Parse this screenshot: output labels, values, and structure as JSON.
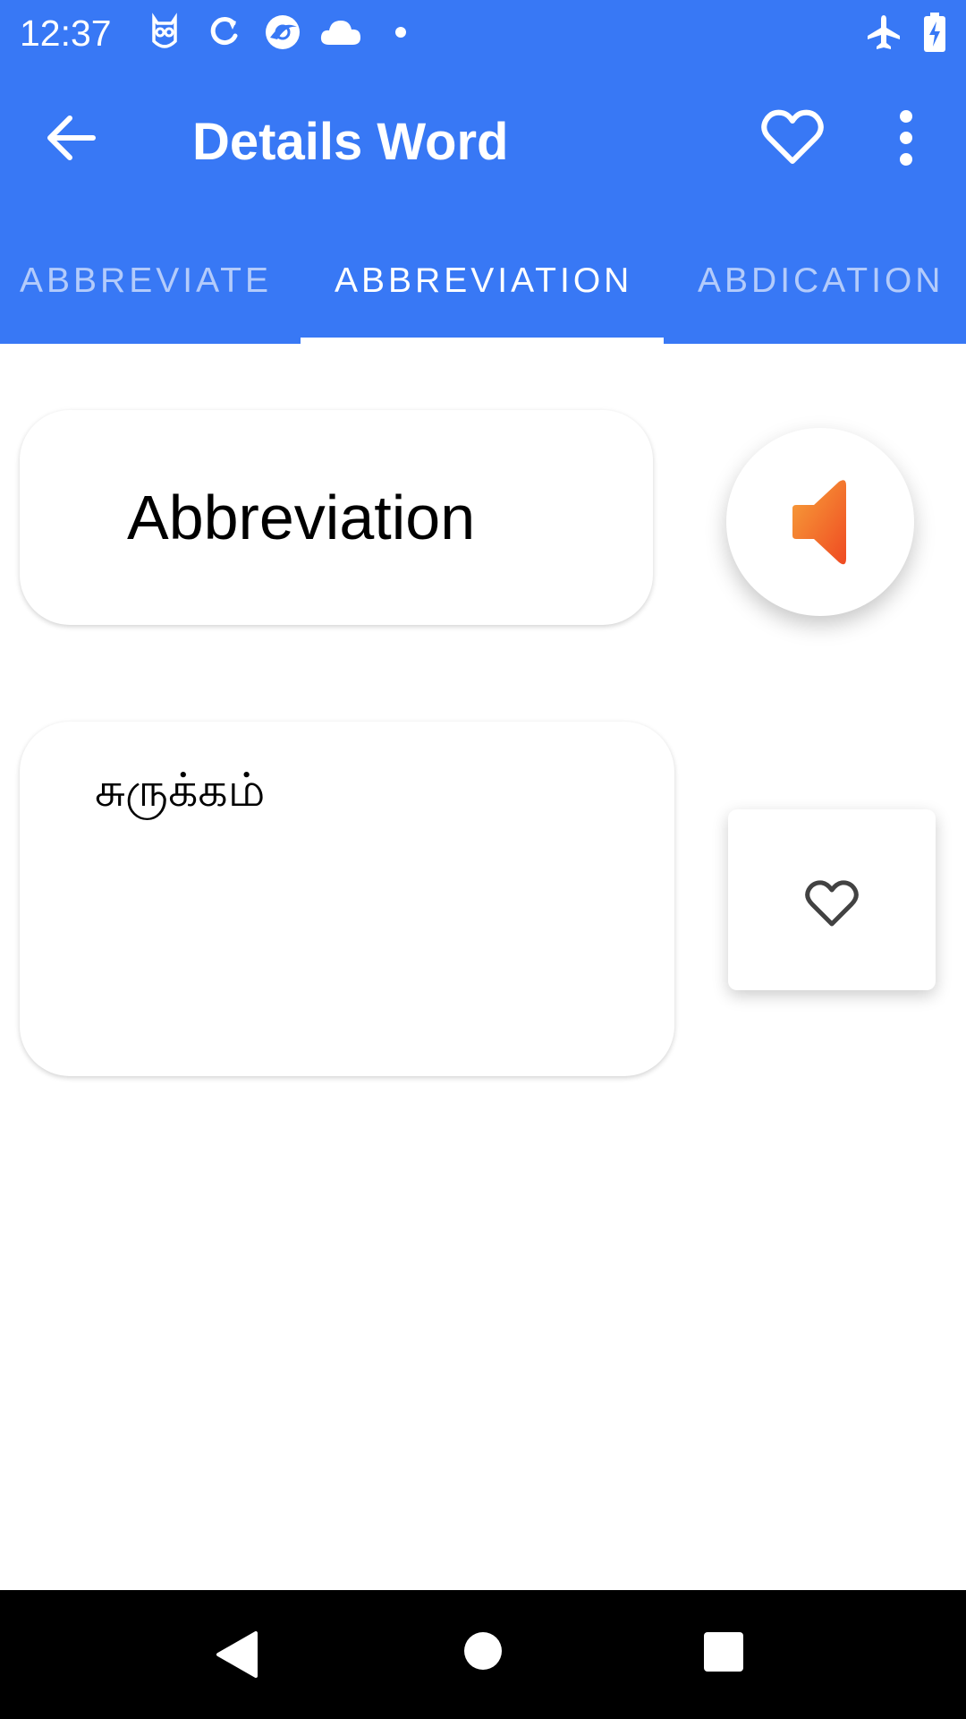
{
  "status_bar": {
    "time": "12:37",
    "icons": [
      "owl-icon",
      "sync-icon",
      "browser-icon",
      "cloud-icon",
      "dot-icon",
      "airplane-mode-icon",
      "battery-charging-icon"
    ]
  },
  "toolbar": {
    "title": "Details Word",
    "back_icon": "arrow-left-icon",
    "favorite_icon": "heart-outline-icon",
    "more_icon": "more-vert-icon"
  },
  "tabs": [
    {
      "label": "ABBREVIATE",
      "active": false
    },
    {
      "label": "ABBREVIATION",
      "active": true
    },
    {
      "label": "ABDICATION",
      "active": false
    }
  ],
  "word": {
    "text": "Abbreviation",
    "speak_icon": "speaker-icon"
  },
  "meaning": {
    "text": "சுருக்கம்"
  },
  "favorite_button_icon": "heart-outline-icon",
  "nav_bar": {
    "icons": [
      "back-triangle-icon",
      "home-circle-icon",
      "recents-square-icon"
    ]
  },
  "colors": {
    "primary": "#3878f5",
    "speaker_orange": "#f26a1f",
    "nav_bar": "#000000"
  }
}
